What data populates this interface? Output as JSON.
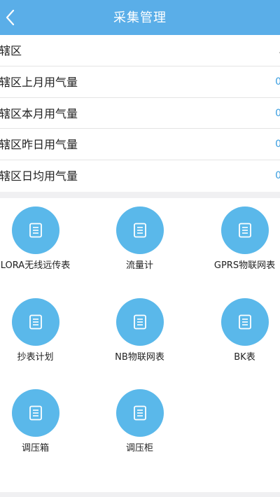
{
  "header": {
    "title": "采集管理",
    "back_icon": "chevron-left-icon"
  },
  "info": [
    {
      "label": "辖区",
      "value": "."
    },
    {
      "label": "辖区上月用气量",
      "value": "0"
    },
    {
      "label": "辖区本月用气量",
      "value": "0"
    },
    {
      "label": "辖区昨日用气量",
      "value": "0"
    },
    {
      "label": "辖区日均用气量",
      "value": "0"
    }
  ],
  "tiles": [
    {
      "label": "LORA无线远传表",
      "icon": "document-list-icon"
    },
    {
      "label": "流量计",
      "icon": "document-list-icon"
    },
    {
      "label": "GPRS物联网表",
      "icon": "document-list-icon"
    },
    {
      "label": "抄表计划",
      "icon": "document-list-icon"
    },
    {
      "label": "NB物联网表",
      "icon": "document-list-icon"
    },
    {
      "label": "BK表",
      "icon": "document-list-icon"
    },
    {
      "label": "调压箱",
      "icon": "document-list-icon"
    },
    {
      "label": "调压柜",
      "icon": "document-list-icon"
    }
  ],
  "colors": {
    "header": "#5aaee8",
    "icon_circle": "#5ab8ea",
    "value": "#3a9ee0"
  }
}
